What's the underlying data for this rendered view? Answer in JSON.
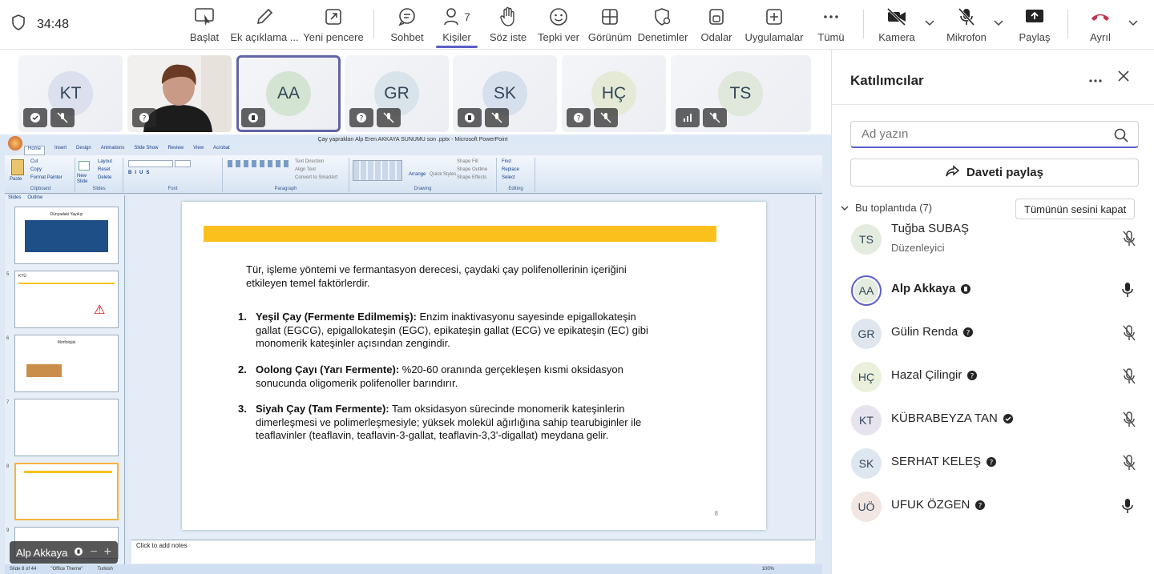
{
  "toolbar": {
    "timer": "34:48",
    "buttons": [
      {
        "label": "Başlat",
        "icon": "screen-start-icon"
      },
      {
        "label": "Ek açıklama ...",
        "icon": "pen-icon"
      },
      {
        "label": "Yeni pencere",
        "icon": "new-window-icon"
      },
      {
        "label": "Sohbet",
        "icon": "chat-icon"
      },
      {
        "label": "Kişiler",
        "icon": "people-icon",
        "count": "7"
      },
      {
        "label": "Söz iste",
        "icon": "raise-hand-icon"
      },
      {
        "label": "Tepki ver",
        "icon": "smile-icon"
      },
      {
        "label": "Görünüm",
        "icon": "grid-icon"
      },
      {
        "label": "Denetimler",
        "icon": "shield-gear-icon"
      },
      {
        "label": "Odalar",
        "icon": "rooms-icon"
      },
      {
        "label": "Uygulamalar",
        "icon": "add-app-icon"
      },
      {
        "label": "Tümü",
        "icon": "more-icon"
      },
      {
        "label": "Kamera",
        "icon": "camera-off-icon"
      },
      {
        "label": "Mikrofon",
        "icon": "mic-off-icon"
      },
      {
        "label": "Paylaş",
        "icon": "share-screen-icon"
      },
      {
        "label": "Ayrıl",
        "icon": "hang-up-icon"
      }
    ],
    "leave_color": "#c4314b"
  },
  "tiles": [
    {
      "initials": "KT"
    },
    {
      "initials": ""
    },
    {
      "initials": "AA"
    },
    {
      "initials": "GR"
    },
    {
      "initials": "SK"
    },
    {
      "initials": "HÇ"
    },
    {
      "initials": "TS"
    }
  ],
  "ppt": {
    "title": "Çay yaprakları Alp Eren AKKAYA SUNUMU son .pptx - Microsoft PowerPoint",
    "tabs": [
      "Home",
      "Insert",
      "Design",
      "Animations",
      "Slide Show",
      "Review",
      "View",
      "Acrobat"
    ],
    "groups": [
      "Clipboard",
      "Slides",
      "Font",
      "Paragraph",
      "Drawing",
      "Editing"
    ],
    "clipboard": [
      "Paste",
      "Cut",
      "Copy",
      "Format Painter"
    ],
    "slides_group": [
      "New Slide",
      "Layout",
      "Reset",
      "Delete"
    ],
    "paragraph_items": [
      "Text Direction",
      "Align Text",
      "Convert to SmartArt"
    ],
    "drawing_items": [
      "Arrange",
      "Quick Styles",
      "Shape Fill",
      "Shape Outline",
      "Shape Effects"
    ],
    "editing_items": [
      "Find",
      "Replace",
      "Select"
    ],
    "panel_tabs": [
      "Slides",
      "Outline"
    ],
    "thumb_numbers": [
      "",
      "5",
      "6",
      "7",
      "8",
      "9"
    ],
    "thumb_titles": [
      "Dünyadaki Yayılışı",
      "KTÜ",
      "Morfolojisi",
      "",
      "",
      ""
    ],
    "slide": {
      "intro": "Tür, işleme yöntemi ve fermantasyon derecesi, çaydaki çay polifenollerinin içeriğini etkileyen temel faktörlerdir.",
      "items": [
        {
          "num": "1.",
          "bold": "Yeşil Çay (Fermente Edilmemiş):",
          "text": " Enzim inaktivasyonu sayesinde epigallokateşin gallat (EGCG), epigallokateşin (EGC), epikateşin gallat (ECG) ve epikateşin (EC) gibi monomerik kateşinler açısından zengindir."
        },
        {
          "num": "2.",
          "bold": "Oolong Çayı (Yarı Fermente):",
          "text": " %20-60 oranında gerçekleşen kısmi oksidasyon sonucunda oligomerik polifenoller barındırır."
        },
        {
          "num": "3.",
          "bold": "Siyah Çay (Tam Fermente):",
          "text": " Tam oksidasyon sürecinde monomerik kateşinlerin dimerleşmesi ve polimerleşmesiyle; yüksek molekül ağırlığına sahip tearubiginler ile teaflavinler (teaflavin, teaflavin-3-gallat, teaflavin-3,3'-digallat) meydana gelir."
        }
      ],
      "page": "8",
      "bar_color": "#fbc01b"
    },
    "notes": "Click to add notes",
    "status": [
      "Slide 8 of 44",
      "\"Office Theme\"",
      "Turkish"
    ],
    "zoom": "100%"
  },
  "presenter": {
    "name": "Alp Akkaya"
  },
  "panel": {
    "title": "Katılımcılar",
    "search_placeholder": "Ad yazın",
    "share_label": "Daveti paylaş",
    "section": "Bu toplantıda (7)",
    "mute_all": "Tümünün sesini kapat",
    "people": [
      {
        "initials": "TS",
        "name": "Tuğba SUBAŞ",
        "role": "Düzenleyici",
        "bg": "#e3ecdf",
        "mic": "off",
        "status": ""
      },
      {
        "initials": "AA",
        "name": "Alp Akkaya",
        "role": "",
        "bg": "#e3ecdf",
        "mic": "on",
        "status": "presenting",
        "bold": true
      },
      {
        "initials": "GR",
        "name": "Gülin Renda",
        "role": "",
        "bg": "#dfe6ee",
        "mic": "off",
        "status": "unknown"
      },
      {
        "initials": "HÇ",
        "name": "Hazal Çilingir",
        "role": "",
        "bg": "#eaf0dc",
        "mic": "off",
        "status": "unknown"
      },
      {
        "initials": "KT",
        "name": "KÜBRABEYZA TAN",
        "role": "",
        "bg": "#e6e3ef",
        "mic": "off",
        "status": "check"
      },
      {
        "initials": "SK",
        "name": "SERHAT KELEŞ",
        "role": "",
        "bg": "#dee6ef",
        "mic": "off",
        "status": "unknown"
      },
      {
        "initials": "UÖ",
        "name": "UFUK ÖZGEN",
        "role": "",
        "bg": "#f1e6e2",
        "mic": "on",
        "status": "unknown"
      }
    ]
  }
}
